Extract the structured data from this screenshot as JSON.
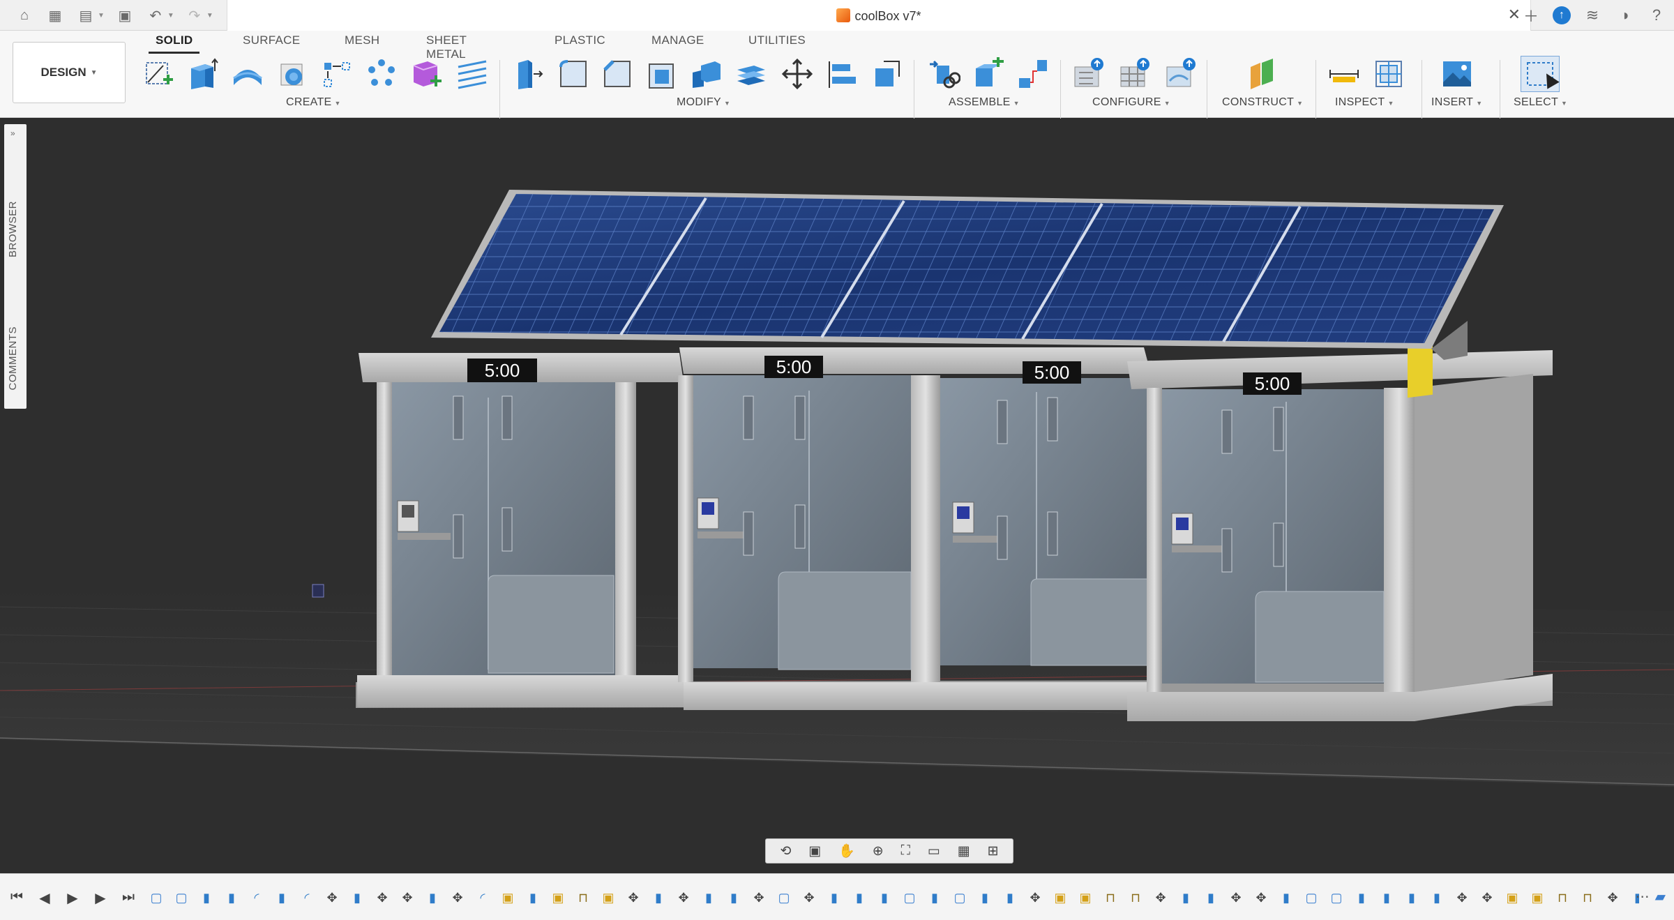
{
  "app": {
    "document_title": "coolBox v7*"
  },
  "toolbar": {
    "workspace_button": "DESIGN",
    "tabs": [
      "SOLID",
      "SURFACE",
      "MESH",
      "SHEET METAL",
      "PLASTIC",
      "MANAGE",
      "UTILITIES"
    ],
    "active_tab": "SOLID",
    "groups": {
      "create": "CREATE",
      "modify": "MODIFY",
      "assemble": "ASSEMBLE",
      "configure": "CONFIGURE",
      "construct": "CONSTRUCT",
      "inspect": "INSPECT",
      "insert": "INSERT",
      "select": "SELECT"
    }
  },
  "side_panel": {
    "browser": "BROWSER",
    "comments": "COMMENTS"
  },
  "scene": {
    "timers": [
      "5:00",
      "5:00",
      "5:00",
      "5:00"
    ]
  },
  "colors": {
    "accent": "#1f7ad1",
    "viewport_bg": "#2e2e2e",
    "solar_panel": "#1d3a78",
    "box_frame": "#9c9c9c"
  }
}
